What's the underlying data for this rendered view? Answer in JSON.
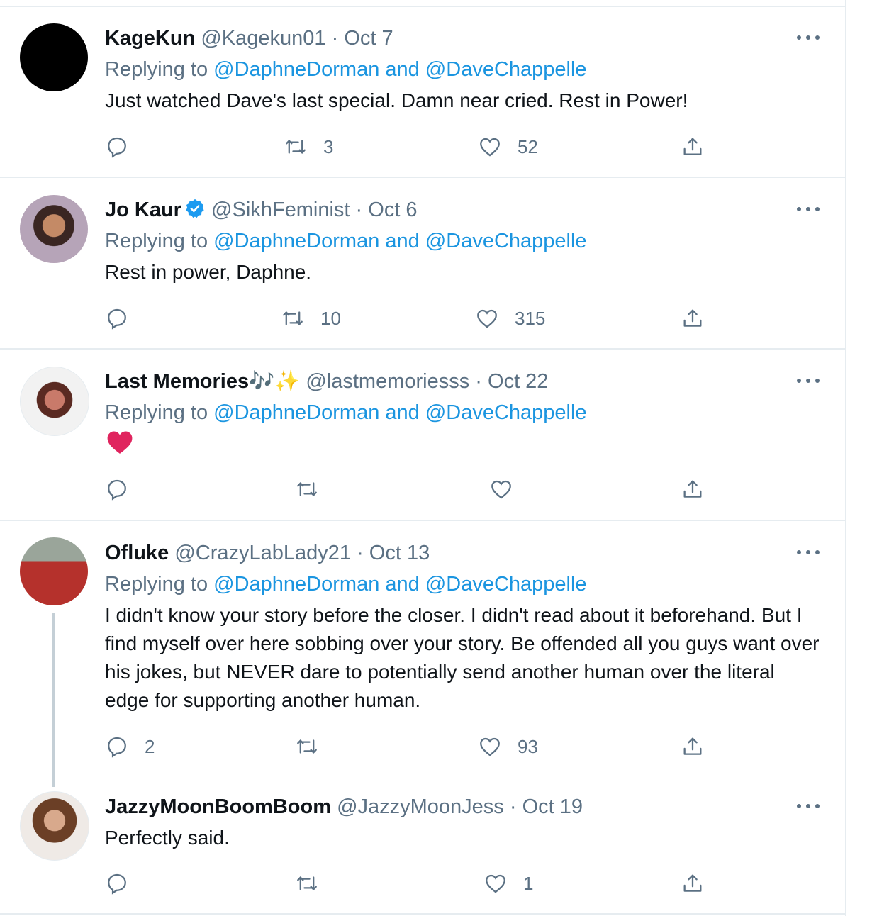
{
  "colors": {
    "link": "#1b95e0",
    "secondary": "#5b7083",
    "text": "#0f1419",
    "heart": "#e0245e"
  },
  "tweets": [
    {
      "name": "KageKun",
      "handle": "@Kagekun01",
      "date": "· Oct 7",
      "reply_prefix": "Replying to",
      "reply_to": "@DaphneDorman and @DaveChappelle",
      "text": "Just watched Dave's last special. Damn near cried. Rest in Power!",
      "replies": "",
      "retweets": "3",
      "likes": "52"
    },
    {
      "name": "Jo Kaur",
      "verified": true,
      "handle": "@SikhFeminist",
      "date": "· Oct 6",
      "reply_prefix": "Replying to",
      "reply_to": "@DaphneDorman and @DaveChappelle",
      "text": "Rest in power, Daphne.",
      "replies": "",
      "retweets": "10",
      "likes": "315"
    },
    {
      "name": "Last Memories",
      "name_emoji": "🎶✨",
      "handle": "@lastmemoriesss",
      "date": "· Oct 22",
      "reply_prefix": "Replying to",
      "reply_to": "@DaphneDorman and @DaveChappelle",
      "text_icon": "red-heart-emoji",
      "replies": "",
      "retweets": "",
      "likes": ""
    },
    {
      "name": "Ofluke",
      "handle": "@CrazyLabLady21",
      "date": "· Oct 13",
      "reply_prefix": "Replying to",
      "reply_to": "@DaphneDorman and @DaveChappelle",
      "text": "I didn't know your story before the closer. I didn't read about it beforehand. But I find myself over here sobbing over your story. Be offended all you guys want over his jokes, but NEVER dare to potentially send another human over the literal edge for supporting another human.",
      "replies": "2",
      "retweets": "",
      "likes": "93"
    },
    {
      "name": "JazzyMoonBoomBoom",
      "handle": "@JazzyMoonJess",
      "date": "· Oct 19",
      "text": "Perfectly said.",
      "replies": "",
      "retweets": "",
      "likes": "1"
    }
  ]
}
